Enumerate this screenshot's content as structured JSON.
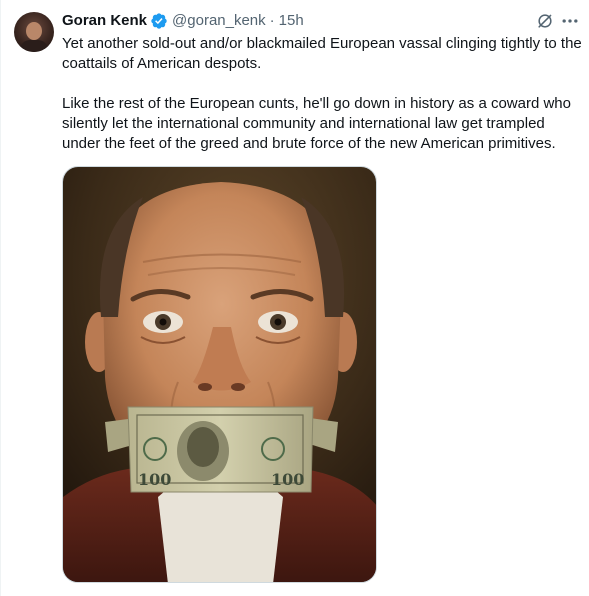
{
  "tweet": {
    "author": {
      "display_name": "Goran Kenk",
      "handle": "@goran_kenk",
      "verified": true,
      "avatar_icon": "profile-photo"
    },
    "separator": "·",
    "time": "15h",
    "paragraphs": [
      "Yet another sold-out and/or blackmailed European vassal clinging tightly to the coattails of American despots.",
      "Like the rest of the European cunts, he'll go down in history as a coward who silently let the international community and international law get trampled under the feet of the greed and brute force of the new American primitives."
    ],
    "actions": {
      "grok_icon": "grok-icon",
      "more_icon": "more-horizontal-icon"
    },
    "media": {
      "type": "image",
      "banknote_text": "100",
      "colors": {
        "background": "#3a2a18",
        "skin": "#c98b62",
        "banknote": "#c9c7a2"
      }
    }
  },
  "colors": {
    "verified_badge": "#1d9bf0",
    "secondary_text": "#536471",
    "primary_text": "#0f1419"
  }
}
